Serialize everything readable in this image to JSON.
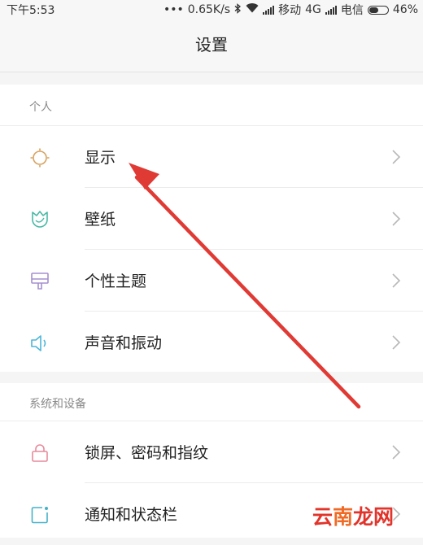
{
  "status_bar": {
    "time": "下午5:53",
    "dots": "•••",
    "network_speed": "0.65K/s",
    "carrier1": "移动",
    "carrier1_tech": "4G",
    "carrier2": "电信",
    "battery_percent": "46%",
    "battery_level": 0.46
  },
  "header": {
    "title": "设置"
  },
  "sections": [
    {
      "label": "个人",
      "items": [
        {
          "label": "显示",
          "icon": "sun-icon",
          "color": "#d6a15e"
        },
        {
          "label": "壁纸",
          "icon": "tulip-icon",
          "color": "#49b9a5"
        },
        {
          "label": "个性主题",
          "icon": "brush-icon",
          "color": "#a58fd0"
        },
        {
          "label": "声音和振动",
          "icon": "speaker-icon",
          "color": "#4cb6d8"
        }
      ]
    },
    {
      "label": "系统和设备",
      "items": [
        {
          "label": "锁屏、密码和指纹",
          "icon": "lock-icon",
          "color": "#e78a9b"
        },
        {
          "label": "通知和状态栏",
          "icon": "notification-icon",
          "color": "#45b1c8"
        }
      ]
    }
  ],
  "watermark": {
    "prefix": "云",
    "highlight": "南",
    "suffix": "龙网"
  },
  "colors": {
    "arrow": "#e03a35",
    "chevron": "#b8b8b8",
    "section_text": "#8a8a8a"
  }
}
